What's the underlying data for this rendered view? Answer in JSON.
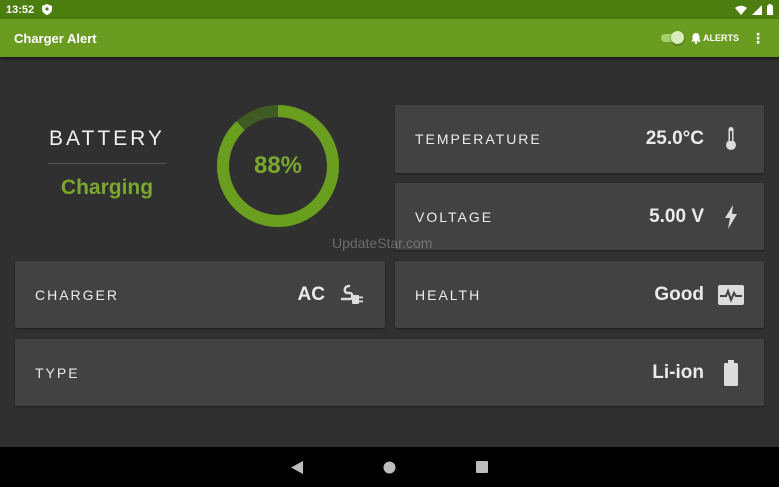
{
  "status_bar": {
    "time": "13:52"
  },
  "app_bar": {
    "title": "Charger Alert",
    "alerts_label": "ALERTS",
    "menu_glyph": "⋮"
  },
  "battery": {
    "label": "BATTERY",
    "status": "Charging",
    "percent_text": "88%",
    "level": 0.88
  },
  "cards": {
    "temperature": {
      "label": "TEMPERATURE",
      "value": "25.0°C"
    },
    "voltage": {
      "label": "VOLTAGE",
      "value": "5.00 V"
    },
    "charger": {
      "label": "CHARGER",
      "value": "AC"
    },
    "health": {
      "label": "HEALTH",
      "value": "Good"
    },
    "type": {
      "label": "TYPE",
      "value": "Li-ion"
    }
  },
  "watermark": "UpdateStar.com",
  "colors": {
    "status_bar": "#4b7d0f",
    "app_bar": "#699c21",
    "accent": "#7aa82c",
    "background": "#303030",
    "card": "#424242"
  },
  "icons": [
    "shield-icon",
    "wifi-icon",
    "signal-icon",
    "battery-status-icon",
    "bell-icon",
    "more-vert-icon",
    "thermometer-icon",
    "bolt-icon",
    "plug-icon",
    "heart-monitor-icon",
    "battery-icon",
    "back-icon",
    "home-icon",
    "recents-icon"
  ]
}
